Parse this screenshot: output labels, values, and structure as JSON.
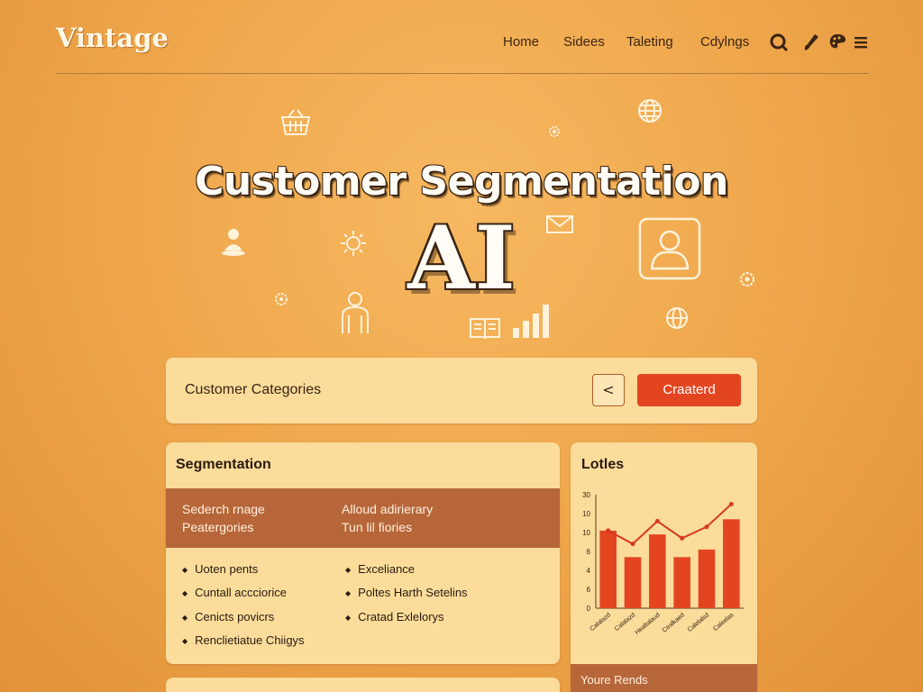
{
  "header": {
    "logo": "Vintage",
    "nav": [
      "Home",
      "Sidees",
      "Taleting",
      "Cdylngs"
    ],
    "icons": [
      "search-icon",
      "brush-icon",
      "palette-icon",
      "menu-icon"
    ]
  },
  "hero": {
    "title": "Customer Segmentation",
    "subtitle": "AI",
    "decor_icons": [
      "basket-icon",
      "globe-icon",
      "gear-icon",
      "envelope-icon",
      "person-icon",
      "sun-icon",
      "cog-icon",
      "profile-frame-icon",
      "book-icon",
      "bar-chart-icon",
      "globe-icon",
      "gear-icon"
    ]
  },
  "categories_bar": {
    "label": "Customer Categories",
    "back_symbol": "<",
    "create_label": "Craaterd"
  },
  "segmentation": {
    "title": "Segmentation",
    "band": [
      [
        "Sederch rnage",
        "Peatergories"
      ],
      [
        "Alloud adirierary",
        "Tun lil fiories"
      ]
    ],
    "left_bullets": [
      "Uoten pents",
      "Cuntall accciorice",
      "Cenicts povicrs",
      "Renclietiatue Chiigys"
    ],
    "right_bullets": [
      "Exceliance",
      "Poltes Harth Setelins",
      "Cratad Exlelorys"
    ]
  },
  "chart_card": {
    "title": "Lotles",
    "footer": "Youre Rends"
  },
  "chart_data": {
    "type": "bar",
    "title": "Lotles",
    "yticks": [
      "30",
      "10",
      "10",
      "6",
      "4",
      "6",
      "0"
    ],
    "categories": [
      "Calalazd",
      "Calalazd",
      "Healtalaud",
      "Cealkaed",
      "Calelalsd",
      "Caleelas"
    ],
    "values": [
      20.5,
      13.5,
      19.5,
      13.5,
      15.5,
      23.5
    ],
    "line_values": [
      20.5,
      17,
      23,
      18.5,
      21.5,
      27.5
    ],
    "ylim": [
      0,
      30
    ],
    "bar_color": "#e44521",
    "line_color": "#d8391e"
  },
  "colors": {
    "accent": "#e44521",
    "band": "#b7663a",
    "card": "#fbdc9b"
  }
}
